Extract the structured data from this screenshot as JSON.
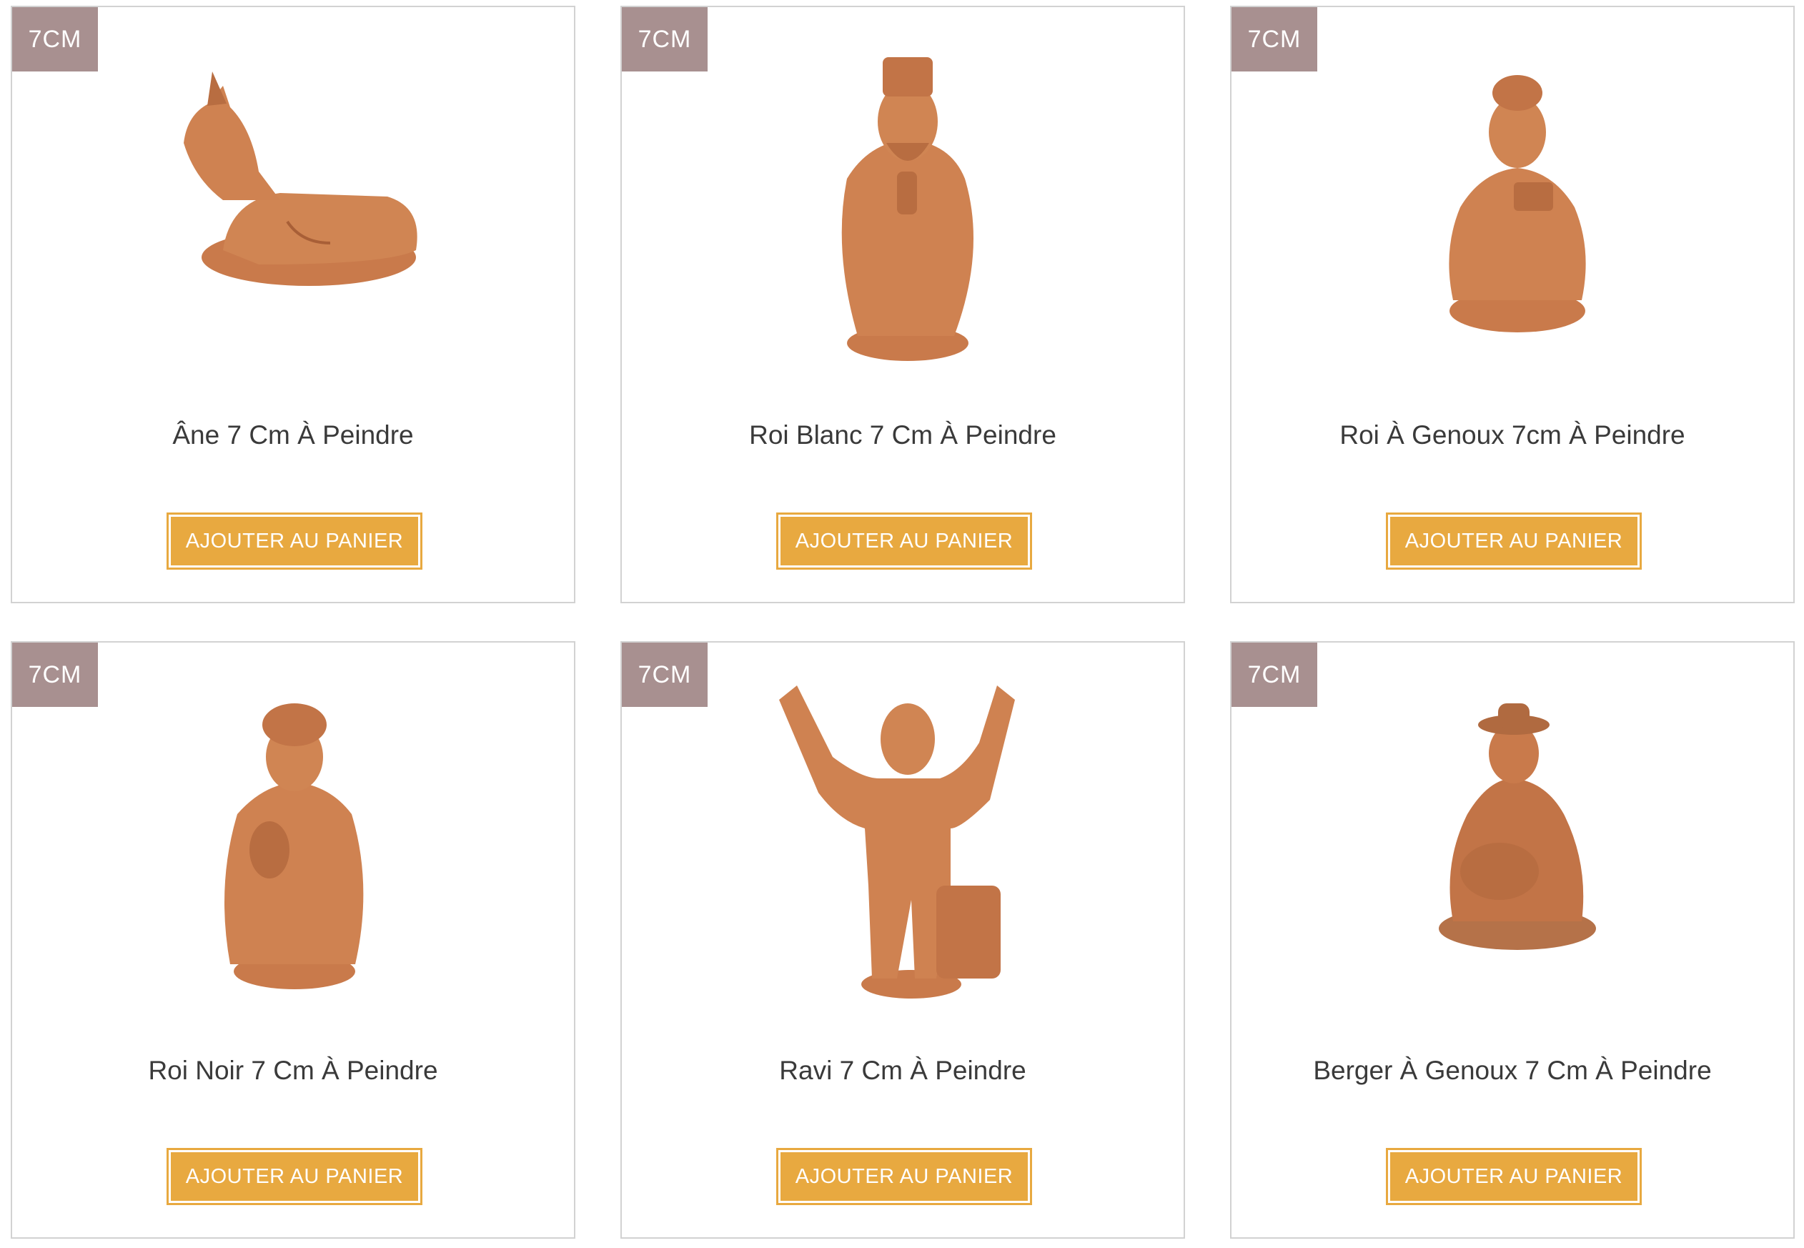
{
  "products": [
    {
      "badge": "7CM",
      "title": "Âne 7 Cm À Peindre",
      "button": "AJOUTER AU PANIER",
      "figure": "donkey-figurine"
    },
    {
      "badge": "7CM",
      "title": "Roi Blanc 7 Cm À Peindre",
      "button": "AJOUTER AU PANIER",
      "figure": "white-king-figurine"
    },
    {
      "badge": "7CM",
      "title": "Roi À Genoux 7cm À Peindre",
      "button": "AJOUTER AU PANIER",
      "figure": "kneeling-king-figurine"
    },
    {
      "badge": "7CM",
      "title": "Roi Noir 7 Cm À Peindre",
      "button": "AJOUTER AU PANIER",
      "figure": "black-king-figurine"
    },
    {
      "badge": "7CM",
      "title": "Ravi 7 Cm À Peindre",
      "button": "AJOUTER AU PANIER",
      "figure": "ravi-figurine"
    },
    {
      "badge": "7CM",
      "title": "Berger À Genoux 7 Cm À Peindre",
      "button": "AJOUTER AU PANIER",
      "figure": "kneeling-shepherd-figurine"
    }
  ],
  "colors": {
    "badge": "#a89090",
    "button": "#e8a940",
    "terracotta": "#c9784a"
  }
}
